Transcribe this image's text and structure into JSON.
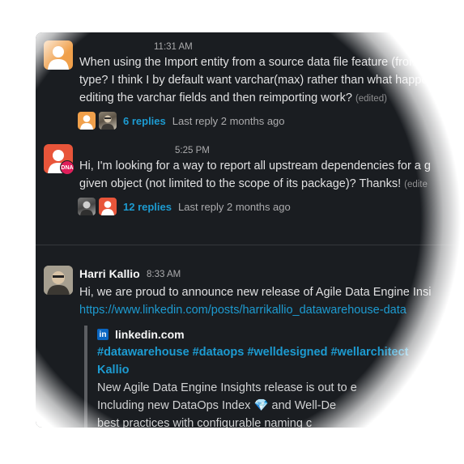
{
  "messages": [
    {
      "time": "11:31 AM",
      "lines": [
        "When using the Import entity from a source data file feature (from a",
        "type? I think I by default want varchar(max) rather than what happe",
        "editing the varchar fields and then reimporting work?"
      ],
      "edited": "(edited)",
      "replies": "6 replies",
      "last_reply": "Last reply 2 months ago"
    },
    {
      "time": "5:25 PM",
      "avatar_badge": "DNA",
      "lines": [
        "Hi, I'm looking for a way to report all upstream dependencies for a g",
        "given object (not limited to the scope of its package)? Thanks!"
      ],
      "edited": "(edite",
      "replies": "12 replies",
      "last_reply": "Last reply 2 months ago"
    },
    {
      "author": "Harri Kallio",
      "time": "8:33 AM",
      "lines": [
        "Hi, we are proud to announce new release of Agile Data Engine Insi"
      ],
      "link": "https://www.linkedin.com/posts/harrikallio_datawarehouse-data",
      "unfurl": {
        "icon_letters": "in",
        "site": "linkedin.com",
        "title_lines": [
          "#datawarehouse #dataops #welldesigned #wellarchitect",
          "Kallio"
        ],
        "body_lines": [
          "New Agile Data Engine Insights release is out to e",
          "Including new DataOps Index 💎 and Well-De",
          "best practices with configurable naming c"
        ]
      }
    }
  ]
}
